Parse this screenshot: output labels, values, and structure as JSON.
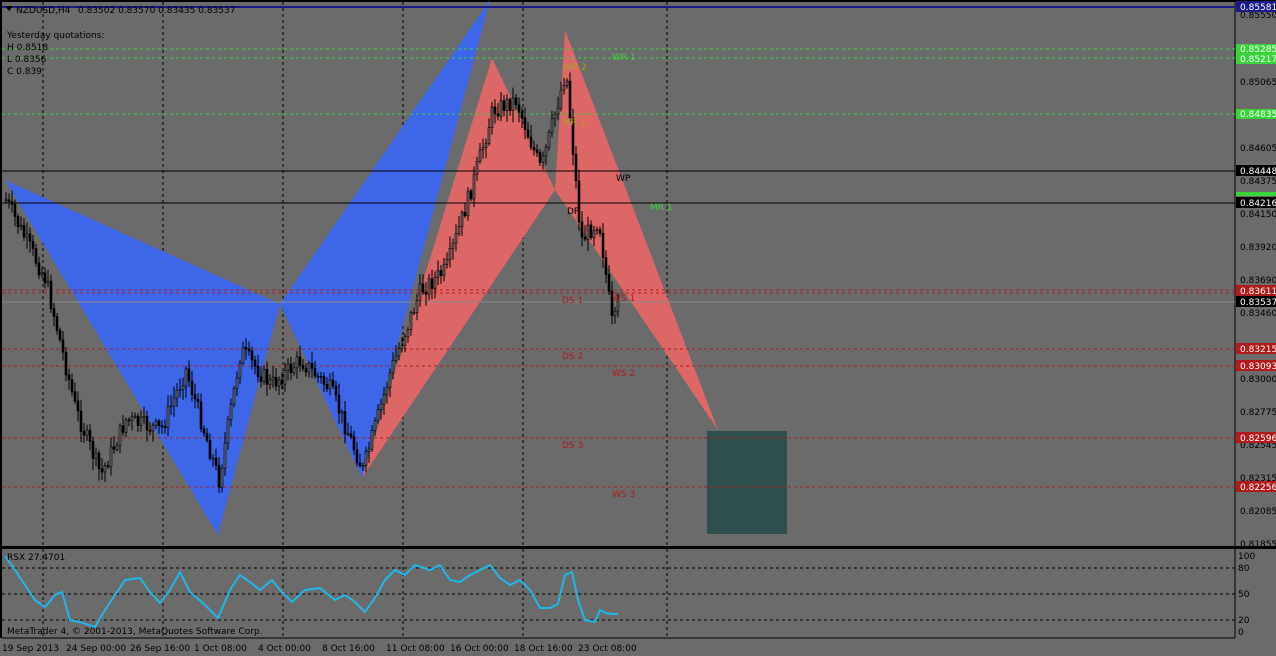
{
  "header": {
    "symbol_label": "NZDUSD,H4",
    "ohlc": "0.83502 0.83570 0.83435 0.83537",
    "yesterday_title": "Yesterday quotations:",
    "high": "H 0.8518",
    "low": "L 0.8356",
    "close": "C 0.839"
  },
  "colors": {
    "background": "#6b6b6b",
    "bull_pattern": "#3d67e8",
    "bear_pattern": "#dd6666",
    "target_zone": "#2f4f4f",
    "candles": "#000000",
    "resistance_line": "#39d439",
    "support_line": "#b01c1c",
    "rsx_line": "#1fb6e8"
  },
  "price_axis": {
    "labels": [
      "0.85550",
      "0.85065",
      "0.84605",
      "0.84375",
      "0.84150",
      "0.83920",
      "0.83690",
      "0.83460",
      "0.83000",
      "0.82775",
      "0.82545",
      "0.82315",
      "0.82085",
      "0.81855"
    ]
  },
  "price_tags": {
    "top": "0.85581",
    "wr2": "0.85285",
    "wr1": "0.85217",
    "mr1": "0.84835",
    "wp": "0.84448",
    "mr2": "0.84216",
    "ds1": "0.83611",
    "bid": "0.83537",
    "ds2": "0.83215",
    "ws2": "0.83093",
    "ds3": "0.82596",
    "ws3": "0.82256"
  },
  "levels": {
    "wr1": "WR 1",
    "wr2": "WR 2",
    "mr1": "MR 1",
    "mr2": "MR 1",
    "wp": "WP",
    "dp": "DP",
    "ds1": "DS 1",
    "ws1": "WS 1",
    "ds2": "DS 2",
    "ws2": "WS 2",
    "ds3": "DS 3",
    "ws3": "WS 3"
  },
  "indicator": {
    "label": "RSX 27.4701",
    "scale": [
      "100",
      "80",
      "50",
      "20",
      "0"
    ]
  },
  "footer": {
    "copyright": "MetaTrader 4, © 2001-2013, MetaQuotes Software Corp."
  },
  "time_axis": {
    "labels": [
      "19 Sep 2013",
      "24 Sep 00:00",
      "26 Sep 16:00",
      "1 Oct 08:00",
      "4 Oct 00:00",
      "8 Oct 16:00",
      "11 Oct 08:00",
      "16 Oct 00:00",
      "18 Oct 16:00",
      "23 Oct 08:00"
    ]
  }
}
